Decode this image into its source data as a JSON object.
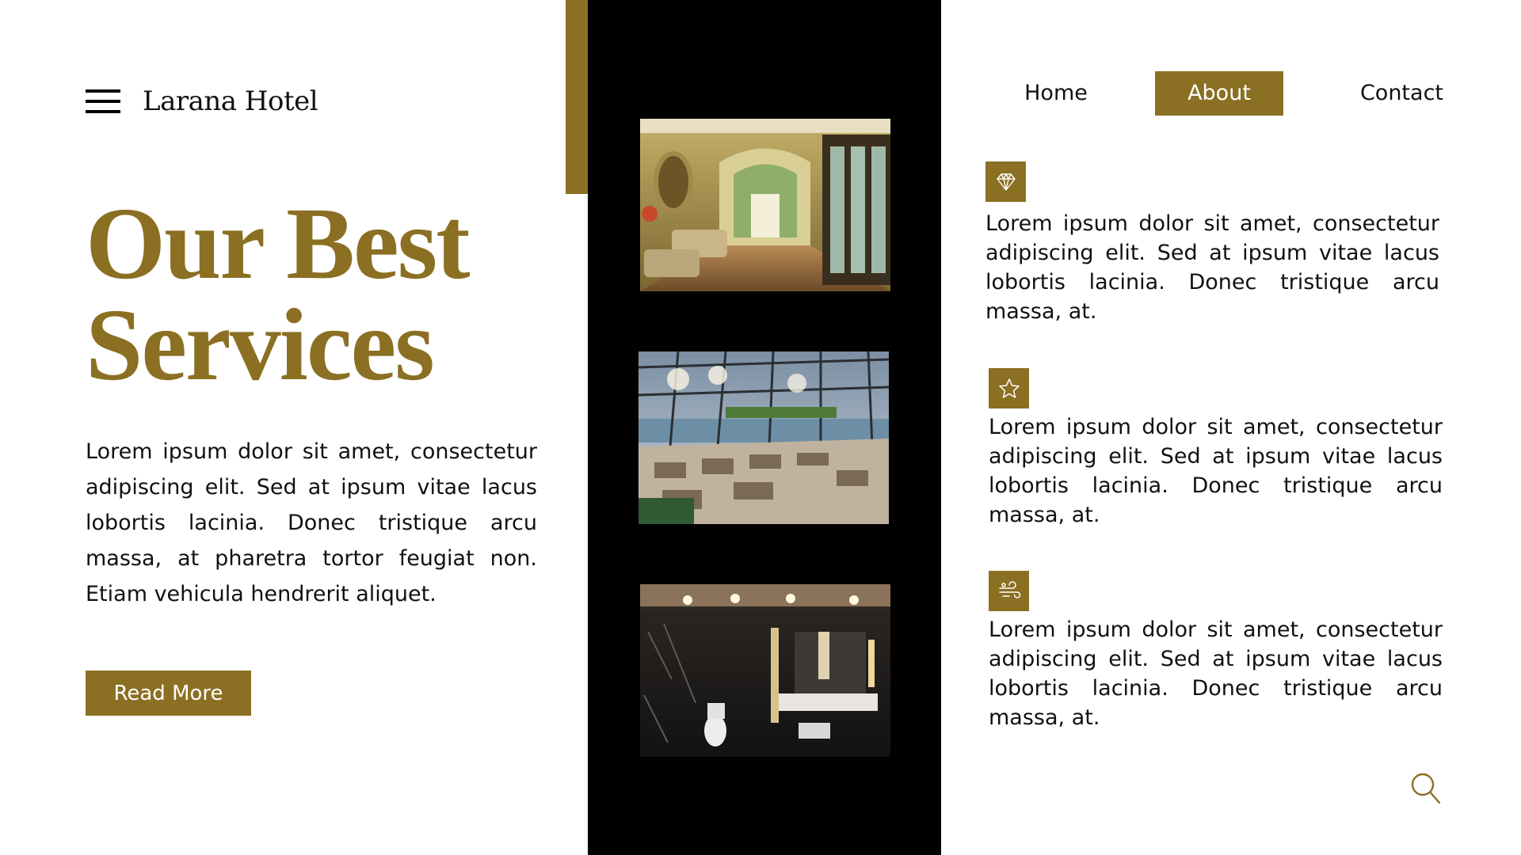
{
  "brand": {
    "name": "Larana Hotel",
    "menu_icon": "hamburger-menu-icon"
  },
  "nav": {
    "items": [
      {
        "label": "Home",
        "active": false
      },
      {
        "label": "About",
        "active": true
      },
      {
        "label": "Contact",
        "active": false
      }
    ]
  },
  "hero": {
    "title_line1": "Our Best",
    "title_line2": "Services",
    "body": "Lorem ipsum dolor sit amet, consectetur adipiscing elit. Sed at ipsum vitae lacus lobortis lacinia. Donec tristique arcu massa, at pharetra tortor feugiat non. Etiam vehicula hendrerit aliquet.",
    "cta_label": "Read More"
  },
  "gallery": [
    {
      "subject": "hotel-lobby-corridor"
    },
    {
      "subject": "glass-roof-restaurant"
    },
    {
      "subject": "black-marble-bathroom"
    }
  ],
  "features": [
    {
      "icon": "diamond-icon",
      "text": "Lorem ipsum dolor sit amet, consectetur adipiscing elit. Sed at ipsum vitae lacus lobortis lacinia. Donec tristique arcu massa, at."
    },
    {
      "icon": "star-icon",
      "text": "Lorem ipsum dolor sit amet, consectetur adipiscing elit. Sed at ipsum vitae lacus lobortis lacinia. Donec tristique arcu massa, at."
    },
    {
      "icon": "wind-icon",
      "text": "Lorem ipsum dolor sit amet, consectetur adipiscing elit. Sed at ipsum vitae lacus lobortis lacinia. Donec tristique arcu massa, at."
    }
  ],
  "search": {
    "icon": "search-icon"
  },
  "colors": {
    "accent": "#8B6F22",
    "panel": "#000000",
    "background": "#FFFFFF",
    "text": "#111111"
  }
}
